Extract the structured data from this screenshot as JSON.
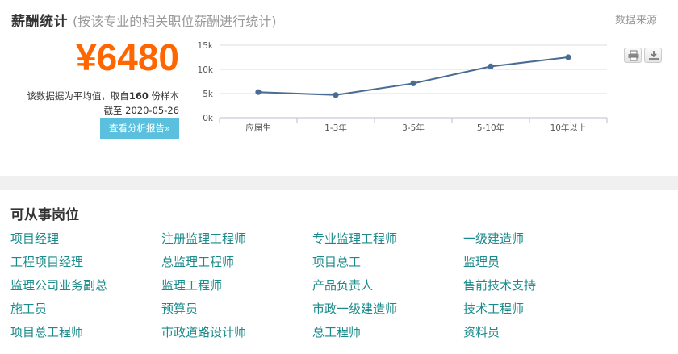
{
  "header": {
    "title": "薪酬统计",
    "subtitle": "(按该专业的相关职位薪酬进行统计)",
    "data_source": "数据来源"
  },
  "summary": {
    "salary": "¥6480",
    "sample_prefix": "该数据据为平均值，取自",
    "sample_count": "160",
    "sample_suffix": " 份样本",
    "date": "截至 2020-05-26",
    "report_button": "查看分析报告»"
  },
  "toolbar": {
    "print_icon": "printer-icon",
    "download_icon": "download-icon"
  },
  "chart_data": {
    "type": "line",
    "categories": [
      "应届生",
      "1-3年",
      "3-5年",
      "5-10年",
      "10年以上"
    ],
    "values": [
      5300,
      4700,
      7100,
      10600,
      12500
    ],
    "y_ticks": [
      "0k",
      "5k",
      "10k",
      "15k"
    ],
    "ylim": [
      0,
      15000
    ],
    "grid": true,
    "line_color": "#4a6b94"
  },
  "jobs": {
    "title": "可从事岗位",
    "items": [
      "项目经理",
      "注册监理工程师",
      "专业监理工程师",
      "一级建造师",
      "工程项目经理",
      "总监理工程师",
      "项目总工",
      "监理员",
      "监理公司业务副总",
      "监理工程师",
      "产品负责人",
      "售前技术支持",
      "施工员",
      "预算员",
      "市政一级建造师",
      "技术工程师",
      "项目总工程师",
      "市政道路设计师",
      "总工程师",
      "资料员"
    ]
  },
  "colors": {
    "accent_orange": "#ff6600",
    "button_blue": "#5bc0de",
    "link_teal": "#1a8a8a"
  }
}
